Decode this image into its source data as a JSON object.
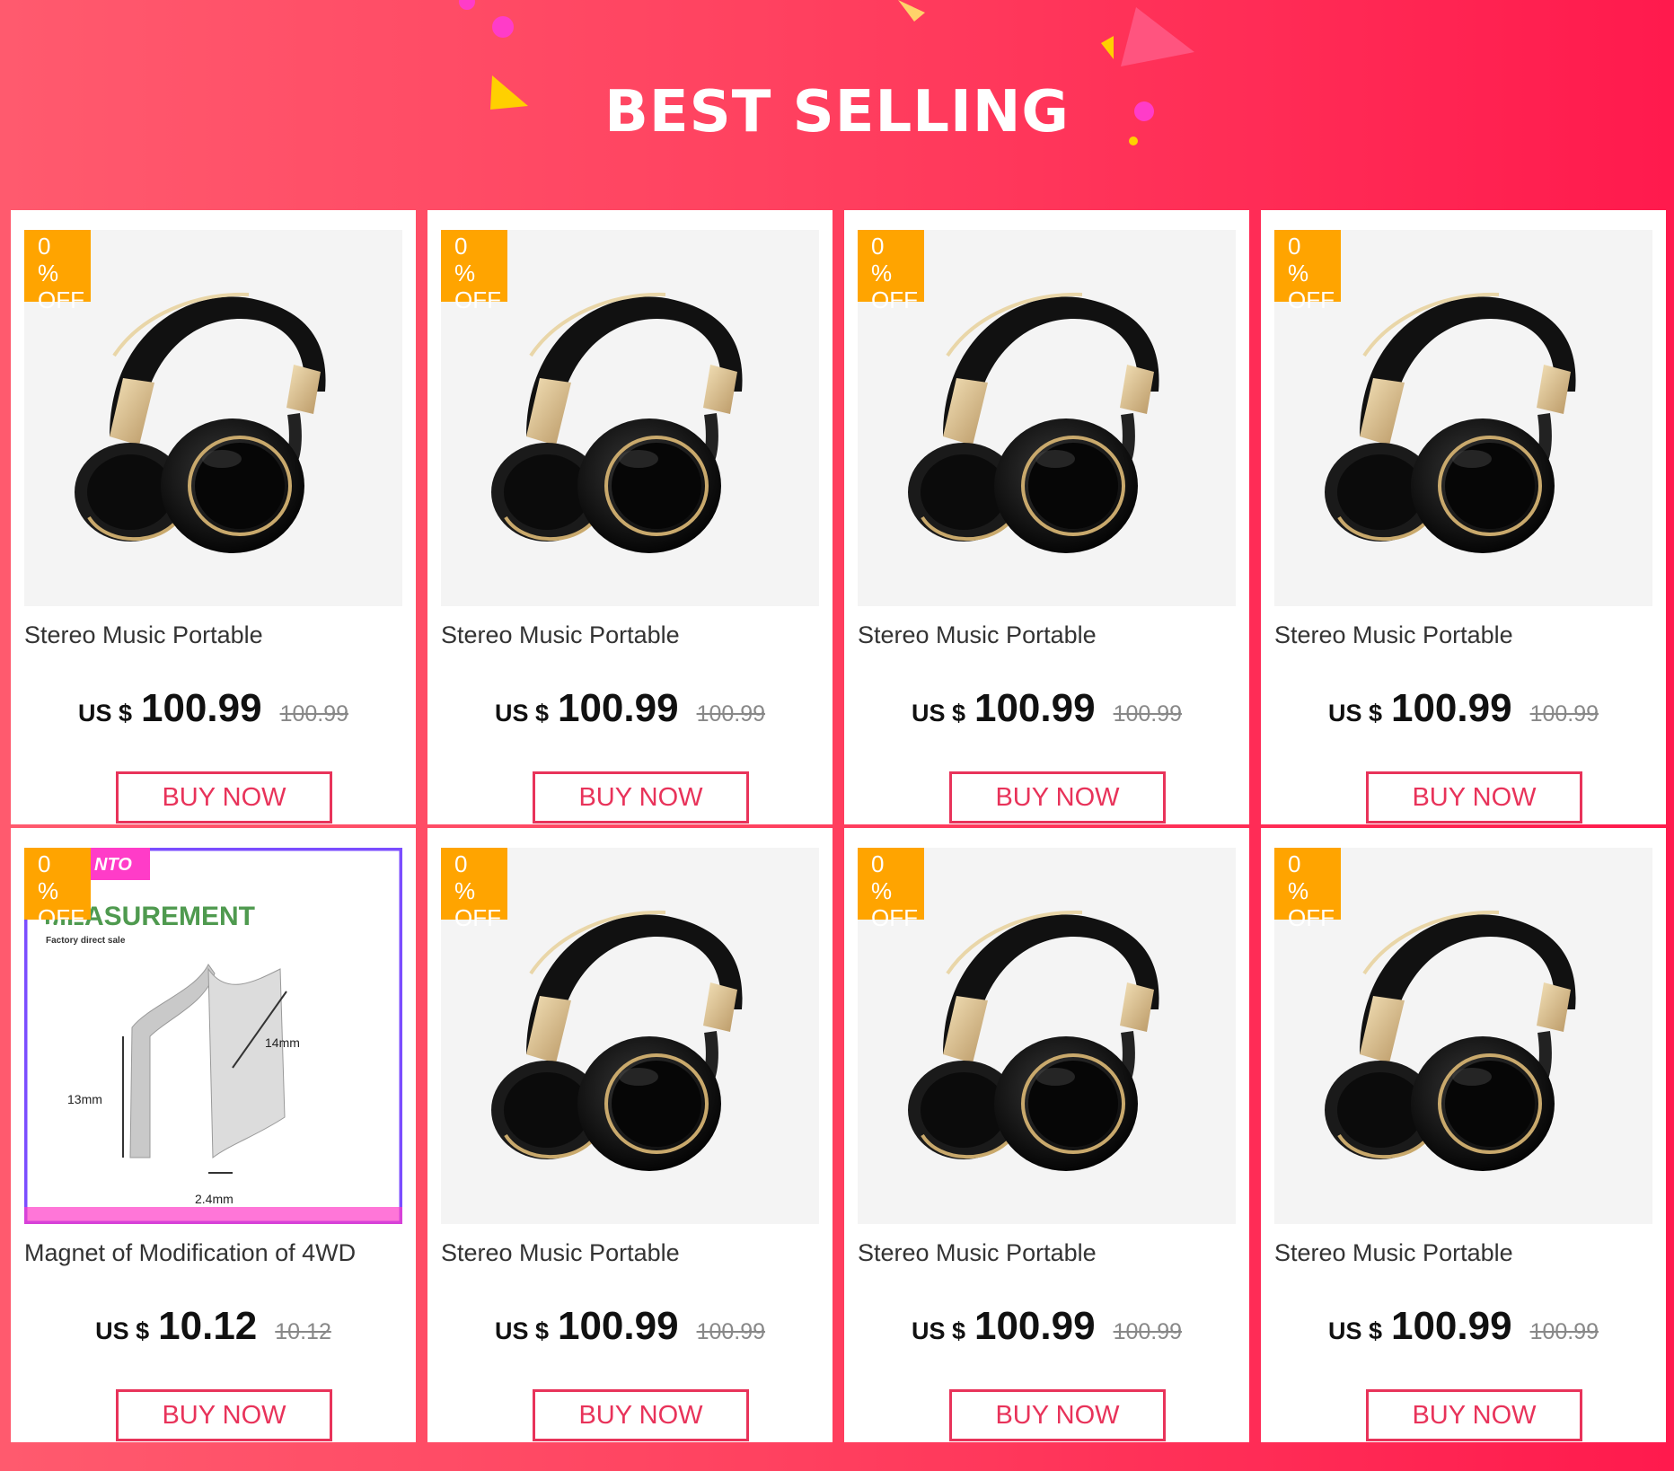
{
  "banner": {
    "title": "BEST SELLING"
  },
  "products": [
    {
      "badge_pct": "0 %",
      "badge_off": "OFF",
      "image": "headphones",
      "title": "Stereo Music Portable",
      "currency": "US $",
      "price": "100.99",
      "old_price": "100.99",
      "button": "BUY NOW"
    },
    {
      "badge_pct": "0 %",
      "badge_off": "OFF",
      "image": "headphones",
      "title": "Stereo Music Portable",
      "currency": "US $",
      "price": "100.99",
      "old_price": "100.99",
      "button": "BUY NOW"
    },
    {
      "badge_pct": "0 %",
      "badge_off": "OFF",
      "image": "headphones",
      "title": "Stereo Music Portable",
      "currency": "US $",
      "price": "100.99",
      "old_price": "100.99",
      "button": "BUY NOW"
    },
    {
      "badge_pct": "0 %",
      "badge_off": "OFF",
      "image": "headphones",
      "title": "Stereo Music Portable",
      "currency": "US $",
      "price": "100.99",
      "old_price": "100.99",
      "button": "BUY NOW"
    },
    {
      "badge_pct": "0 %",
      "badge_off": "OFF",
      "image": "magnet",
      "image_text": {
        "brand": "NTO",
        "heading": "MEASUREMENT",
        "sub": "Factory direct sale",
        "dim_width": "14mm",
        "dim_height": "13mm",
        "dim_thickness": "2.4mm"
      },
      "title": "Magnet of Modification of 4WD",
      "currency": "US $",
      "price": "10.12",
      "old_price": "10.12",
      "button": "BUY NOW"
    },
    {
      "badge_pct": "0 %",
      "badge_off": "OFF",
      "image": "headphones",
      "title": "Stereo Music Portable",
      "currency": "US $",
      "price": "100.99",
      "old_price": "100.99",
      "button": "BUY NOW"
    },
    {
      "badge_pct": "0 %",
      "badge_off": "OFF",
      "image": "headphones",
      "title": "Stereo Music Portable",
      "currency": "US $",
      "price": "100.99",
      "old_price": "100.99",
      "button": "BUY NOW"
    },
    {
      "badge_pct": "0 %",
      "badge_off": "OFF",
      "image": "headphones",
      "title": "Stereo Music Portable",
      "currency": "US $",
      "price": "100.99",
      "old_price": "100.99",
      "button": "BUY NOW"
    }
  ],
  "colors": {
    "accent": "#e8335a",
    "badge": "#ffa400",
    "banner_start": "#ff5a6e",
    "banner_end": "#ff1a4d"
  }
}
